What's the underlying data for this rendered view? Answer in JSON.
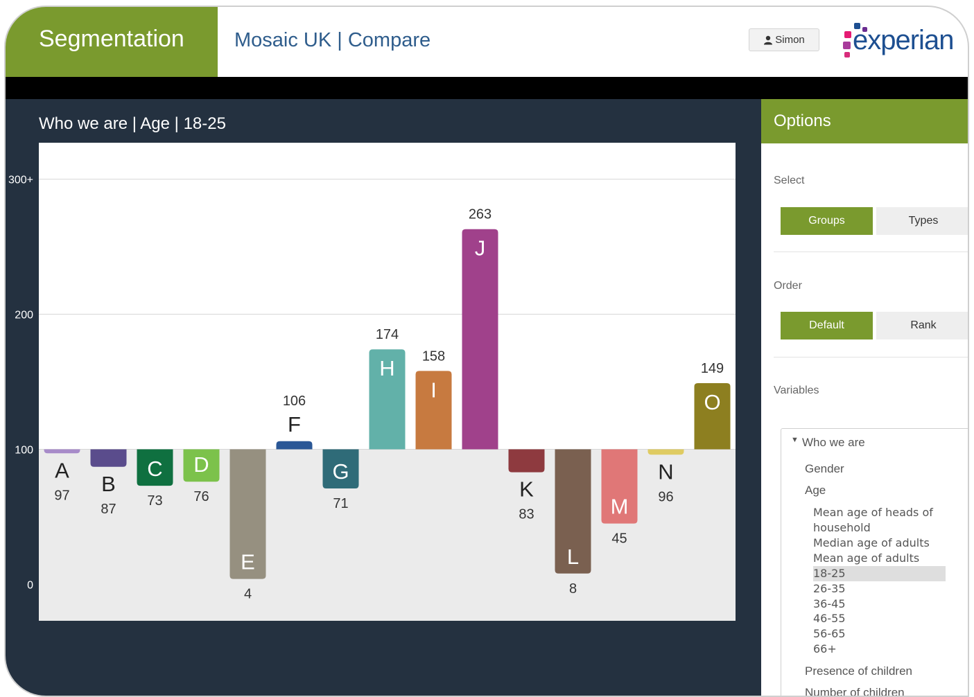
{
  "header": {
    "brand": "Segmentation",
    "title": "Mosaic UK | Compare",
    "user": "Simon",
    "logo_text": "experian",
    "colors": {
      "accent": "#7a9a2e",
      "title": "#2f5d8c",
      "logo": "#1d4f91"
    }
  },
  "main": {
    "chart_title": "Who we are | Age | 18-25"
  },
  "chart_data": {
    "type": "bar",
    "baseline": 100,
    "ylim": [
      -27,
      327
    ],
    "yticks": [
      0,
      100,
      200,
      300
    ],
    "ytick_labels": [
      "0",
      "100",
      "200",
      "300+"
    ],
    "grid": true,
    "categories": [
      "A",
      "B",
      "C",
      "D",
      "E",
      "F",
      "G",
      "H",
      "I",
      "J",
      "K",
      "L",
      "M",
      "N",
      "O"
    ],
    "values": [
      97,
      87,
      73,
      76,
      4,
      106,
      71,
      174,
      158,
      263,
      83,
      8,
      45,
      96,
      149
    ],
    "colors": [
      "#a78bc9",
      "#5a4c8c",
      "#0f7040",
      "#7cc24b",
      "#969080",
      "#2a5796",
      "#2f6b78",
      "#62b1a9",
      "#c77a40",
      "#a0418b",
      "#8e3a3f",
      "#7a6050",
      "#e07777",
      "#dfcb62",
      "#8d7f20"
    ]
  },
  "options": {
    "title": "Options",
    "select_label": "Select",
    "select_buttons": [
      {
        "label": "Groups"
      },
      {
        "label": "Types"
      }
    ],
    "order_label": "Order",
    "order_buttons": [
      {
        "label": "Default"
      },
      {
        "label": "Rank"
      }
    ],
    "variables_label": "Variables",
    "tree": {
      "root": "Who we are",
      "gender": "Gender",
      "age": "Age",
      "age_items": [
        "Mean age of heads of",
        "household",
        "Median age of adults",
        "Mean age of adults",
        "18-25",
        "26-35",
        "36-45",
        "46-55",
        "56-65",
        "66+"
      ],
      "selected": "18-25",
      "presence": "Presence of children",
      "number": "Number of children"
    }
  }
}
